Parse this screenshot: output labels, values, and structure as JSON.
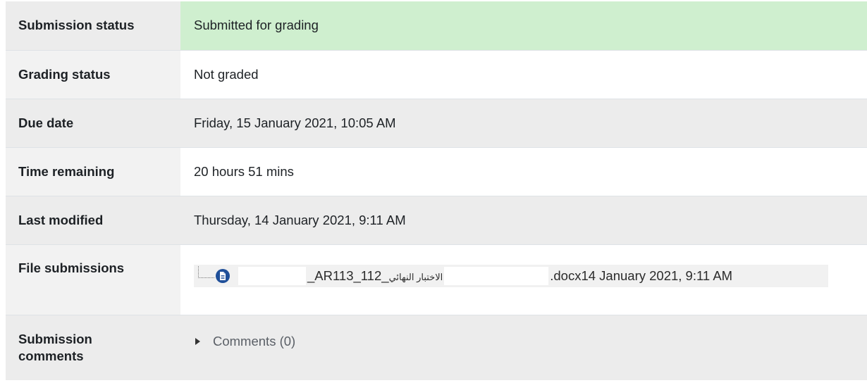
{
  "rows": {
    "submission_status": {
      "label": "Submission status",
      "value": "Submitted for grading"
    },
    "grading_status": {
      "label": "Grading status",
      "value": "Not graded"
    },
    "due_date": {
      "label": "Due date",
      "value": "Friday, 15 January 2021, 10:05 AM"
    },
    "time_remaining": {
      "label": "Time remaining",
      "value": "20 hours 51 mins"
    },
    "last_modified": {
      "label": "Last modified",
      "value": "Thursday, 14 January 2021, 9:11 AM"
    },
    "file_submissions": {
      "label": "File submissions",
      "file_name_part1": "_AR113_112_",
      "file_name_arabic": "الاختبار النهائي",
      "file_name_part2": ".docx",
      "file_date": "14 January 2021, 9:11 AM"
    },
    "submission_comments": {
      "label_line1": "Submission",
      "label_line2": "comments",
      "comments_link": "Comments (0)"
    }
  },
  "colors": {
    "submitted_bg": "#cfefcf",
    "file_icon": "#1f4f99"
  },
  "icons": {
    "file": "document-icon",
    "expand": "caret-right-icon"
  }
}
